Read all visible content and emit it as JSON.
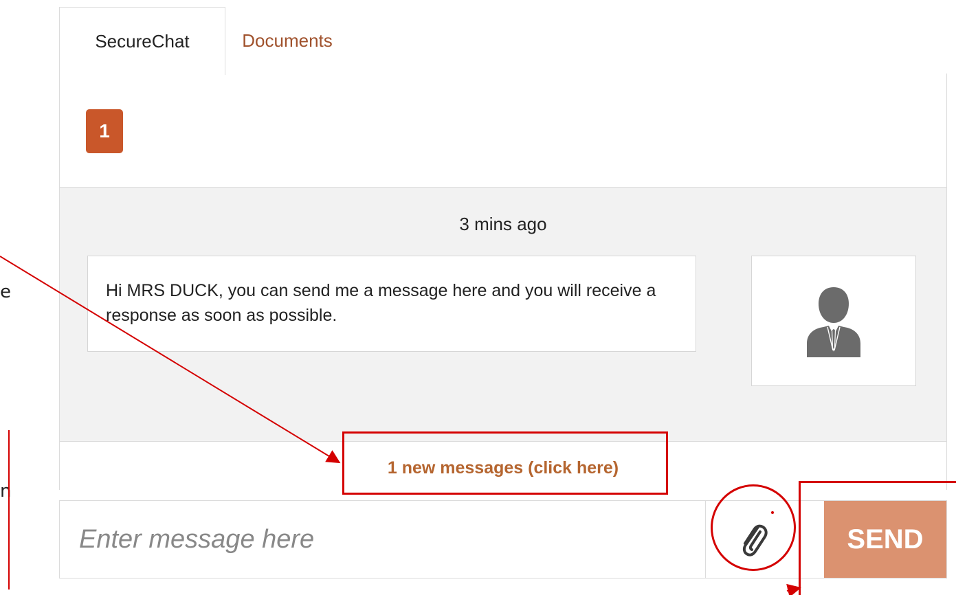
{
  "annotation_left": {
    "chars": [
      "e",
      "n"
    ]
  },
  "tabs": {
    "securechat": "SecureChat",
    "documents": "Documents"
  },
  "badge": {
    "count": "1"
  },
  "chat": {
    "timestamp": "3 mins ago",
    "message": "Hi MRS DUCK, you can send me a message here and you will receive a response as soon as possible.",
    "avatar_icon": "user-silhouette-icon"
  },
  "notice": {
    "new_messages": "1 new messages (click here)"
  },
  "composer": {
    "placeholder": "Enter message here",
    "attach_icon": "paperclip-icon",
    "send_label": "SEND"
  },
  "colors": {
    "accent": "#c9572a",
    "link": "#b5652f",
    "send_bg": "#db9270",
    "annotation": "#d40000",
    "chat_bg": "#f2f2f2"
  }
}
